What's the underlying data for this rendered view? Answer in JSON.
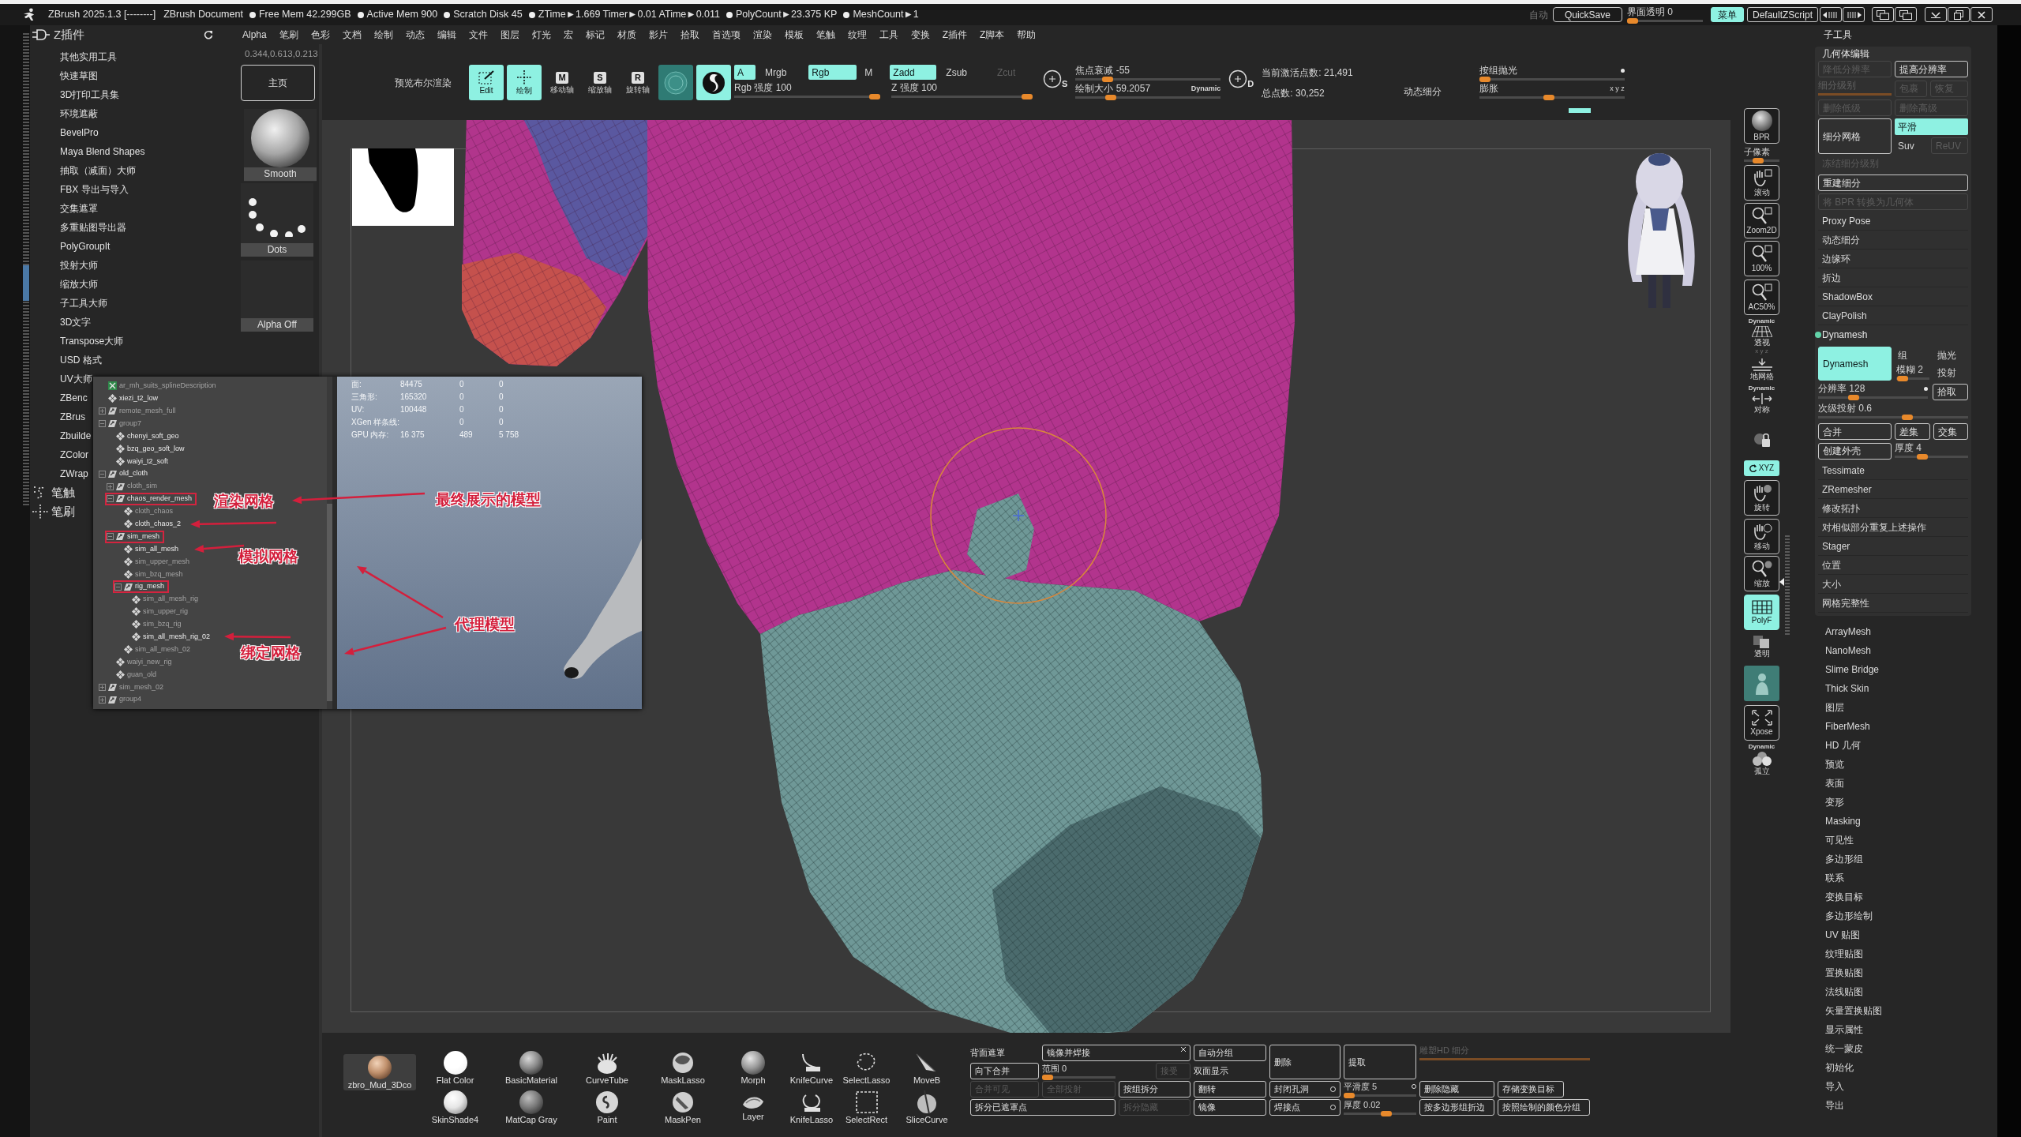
{
  "title_bar": {
    "app_title": "ZBrush 2025.1.3 [--------]",
    "document": "ZBrush Document",
    "stats": [
      "Free Mem 42.299GB",
      "Active Mem 900",
      "Scratch Disk 45",
      "ZTime►1.669 Timer►0.01 ATime►0.011",
      "PolyCount►23.375 KP",
      "MeshCount►1"
    ],
    "auto_label": "自动",
    "quicksave": "QuickSave",
    "ui_transparency": {
      "label": "界面透明 0",
      "level": 0
    },
    "menu_toggle": {
      "label": "菜单",
      "on": true
    },
    "zscript": "DefaultZScript"
  },
  "menu": [
    "Alpha",
    "笔刷",
    "色彩",
    "文档",
    "绘制",
    "动态",
    "编辑",
    "文件",
    "图层",
    "灯光",
    "宏",
    "标记",
    "材质",
    "影片",
    "拾取",
    "首选项",
    "渲染",
    "模板",
    "笔触",
    "纹理",
    "工具",
    "变换",
    "Z插件",
    "Z脚本",
    "帮助"
  ],
  "plugin_panel": {
    "title": "Z插件",
    "items": [
      "其他实用工具",
      "快速草图",
      "3D打印工具集",
      "环境遮蔽",
      "BevelPro",
      "Maya Blend Shapes",
      "抽取（减面）大师",
      "FBX 导出与导入",
      "交集遮罩",
      "多重贴图导出器",
      "PolyGroupIt",
      "投射大师",
      "缩放大师",
      "子工具大师",
      "3D文字",
      "Transpose大师",
      "USD 格式",
      "UV大师",
      "ZBenc",
      "ZBrus",
      "Zbuilde",
      "ZColor",
      "ZWrap"
    ],
    "palettes": [
      {
        "kind": "stroke",
        "label": "笔触"
      },
      {
        "kind": "brush",
        "label": "笔刷"
      }
    ]
  },
  "brush_column": {
    "color_value": "0.344,0.613,0.213",
    "home_button": "主页",
    "brush": "Smooth",
    "stroke": "Dots",
    "alpha": "Alpha Off"
  },
  "toolbar": {
    "boolean_preview": "预览布尔渲染",
    "tools": [
      {
        "kind": "edit",
        "label": "Edit",
        "on": true
      },
      {
        "kind": "draw",
        "label": "绘制",
        "on": true
      },
      {
        "kind": "move",
        "glyph": "M",
        "label": "移动轴",
        "on": false
      },
      {
        "kind": "scale",
        "glyph": "S",
        "label": "缩放轴",
        "on": false
      },
      {
        "kind": "rotate",
        "glyph": "R",
        "label": "旋转轴",
        "on": false
      },
      {
        "kind": "material",
        "on": false
      },
      {
        "kind": "brush",
        "on": true
      }
    ],
    "channels": [
      {
        "label": "A",
        "on": true,
        "disabled": false
      },
      {
        "label": "Mrgb",
        "on": false,
        "disabled": false
      },
      {
        "label": "Rgb",
        "on": true,
        "disabled": false
      },
      {
        "label": "M",
        "on": false,
        "disabled": false
      },
      {
        "label": "Zadd",
        "on": true,
        "disabled": false
      },
      {
        "label": "Zsub",
        "on": false,
        "disabled": false
      },
      {
        "label": "Zcut",
        "on": false,
        "disabled": true
      }
    ],
    "rgb_intensity": {
      "label": "Rgb 强度 100",
      "level": 1
    },
    "z_intensity": {
      "label": "Z 强度 100",
      "level": 1
    },
    "focal_shift": {
      "glyph": "S",
      "label": "焦点衰减 -55",
      "level": 0.2
    },
    "draw_size": {
      "glyph": "D",
      "label": "绘制大小 59.2057",
      "level": 0.22,
      "dynamic": "Dynamic"
    },
    "active_points": "当前激活点数: 21,491",
    "total_points": "总点数: 30,252",
    "dynamic_subdiv": "动态细分",
    "group_polish": {
      "label": "按组抛光",
      "level": 0
    },
    "inflate": {
      "label": "膨胀",
      "level": 0.48,
      "axes": "x y z"
    }
  },
  "subtool_title": "子工具",
  "geometry": {
    "title": "几何体编辑",
    "lower_res": {
      "label": "降低分辨率",
      "disabled": true
    },
    "higher_res": {
      "label": "提高分辨率",
      "disabled": false
    },
    "sdiv": {
      "label": "细分级别",
      "level": 1,
      "disabled": true
    },
    "cage": {
      "label": "包裹",
      "disabled": true
    },
    "restore": {
      "label": "恢复",
      "disabled": true
    },
    "del_lower": {
      "label": "删除低级",
      "disabled": true
    },
    "del_higher": {
      "label": "删除高级",
      "disabled": true
    },
    "divide": "细分网格",
    "smooth": {
      "label": "平滑",
      "on": true
    },
    "suv": {
      "label": "Suv",
      "on": false
    },
    "reuv": {
      "label": "ReUV",
      "disabled": true
    },
    "freeze": {
      "label": "冻结细分级别",
      "disabled": true
    },
    "reconstruct": {
      "label": "重建细分",
      "disabled": false
    },
    "bpr_to_geo": {
      "label": "将 BPR 转换为几何体",
      "disabled": true
    },
    "items_before": [
      "Proxy Pose",
      "动态细分",
      "边缘环",
      "折边",
      "ShadowBox",
      "ClayPolish"
    ],
    "dynamesh": {
      "title": "Dynamesh",
      "button": {
        "label": "Dynamesh",
        "on": true
      },
      "group": {
        "label": "组",
        "on": false
      },
      "polish": {
        "label": "抛光",
        "on": false
      },
      "blur": {
        "label": "模糊 2",
        "level": 0.05
      },
      "project": {
        "label": "投射",
        "on": false
      },
      "resolution": {
        "label": "分辨率 128",
        "level": 0.3
      },
      "pick": "拾取",
      "subprojection": {
        "label": "次级投射 0.6",
        "level": 0.6
      },
      "add": "合并",
      "sub": "差集",
      "and": "交集",
      "create_shell": "创建外壳",
      "thickness": {
        "label": "厚度 4",
        "level": 0.35
      }
    },
    "items_after": [
      "Tessimate",
      "ZRemesher",
      "修改拓扑",
      "对相似部分重复上述操作",
      "Stager",
      "位置",
      "大小",
      "网格完整性"
    ]
  },
  "tool_palettes": [
    "ArrayMesh",
    "NanoMesh",
    "Slime Bridge",
    "Thick Skin",
    "图层",
    "FiberMesh",
    "HD 几何",
    "预览",
    "表面",
    "变形",
    "Masking",
    "可见性",
    "多边形组",
    "联系",
    "变换目标",
    "多边形绘制",
    "UV 贴图",
    "纹理贴图",
    "置换贴图",
    "法线贴图",
    "矢量置换贴图",
    "显示属性",
    "统一蒙皮",
    "初始化",
    "导入",
    "导出"
  ],
  "view_shelf": [
    {
      "kind": "bpr",
      "label": "BPR",
      "on": false
    },
    {
      "kind": "slider",
      "label": "子像素",
      "level": 0.35
    },
    {
      "kind": "hand",
      "label": "滚动",
      "on": false
    },
    {
      "kind": "zoom",
      "label": "Zoom2D",
      "on": false
    },
    {
      "kind": "zoom",
      "label": "100%",
      "on": false
    },
    {
      "kind": "zoom",
      "label": "AC50%",
      "on": false
    },
    {
      "kind": "persp",
      "top": "Dynamic",
      "label": "透视",
      "on": false
    },
    {
      "kind": "floor",
      "top": "x y z",
      "label": "地网格",
      "on": false
    },
    {
      "kind": "sym",
      "top": "Dynamic",
      "label": "对称",
      "on": false
    },
    {
      "kind": "lock",
      "on": false
    },
    {
      "kind": "xyz",
      "label": "XYZ",
      "on": true
    },
    {
      "kind": "rotate",
      "label": "旋转",
      "on": false
    },
    {
      "kind": "move",
      "label": "移动",
      "on": false
    },
    {
      "kind": "scale",
      "label": "缩放",
      "on": false
    },
    {
      "kind": "polyf",
      "label": "PolyF",
      "on": true
    },
    {
      "kind": "transp",
      "label": "透明",
      "on": false
    },
    {
      "kind": "ghost",
      "on": true
    },
    {
      "kind": "xpose",
      "label": "Xpose",
      "on": false
    },
    {
      "kind": "solo",
      "top": "Dynamic",
      "label": "孤立",
      "on": false
    }
  ],
  "shelf": [
    {
      "kind": "clay",
      "label": "zbro_Mud_3Dco",
      "selected": true
    },
    {
      "kind": "flat",
      "label": "Flat Color",
      "selected": false
    },
    {
      "kind": "basic",
      "label": "BasicMaterial",
      "selected": false
    },
    {
      "kind": "curvetube",
      "label": "CurveTube",
      "selected": false
    },
    {
      "kind": "masklasso",
      "label": "MaskLasso",
      "selected": false
    },
    {
      "kind": "morph",
      "label": "Morph",
      "selected": false
    },
    {
      "kind": "knifecurve",
      "label": "KnifeCurve",
      "selected": false
    },
    {
      "kind": "selectlasso",
      "label": "SelectLasso",
      "selected": false
    },
    {
      "kind": "moveb",
      "label": "MoveB",
      "selected": false
    },
    {
      "kind": "skinshade",
      "label": "SkinShade4",
      "selected": false
    },
    {
      "kind": "matcap",
      "label": "MatCap Gray",
      "selected": false
    },
    {
      "kind": "paint",
      "label": "Paint",
      "selected": false
    },
    {
      "kind": "maskpen",
      "label": "MaskPen",
      "selected": false
    },
    {
      "kind": "layer",
      "label": "Layer",
      "selected": false
    },
    {
      "kind": "knifelasso",
      "label": "KnifeLasso",
      "selected": false
    },
    {
      "kind": "selectrect",
      "label": "SelectRect",
      "selected": false
    },
    {
      "kind": "slicecurve",
      "label": "SliceCurve",
      "selected": false
    }
  ],
  "mesh_ops": [
    {
      "kind": "label",
      "label": "背面遮罩",
      "disabled": false
    },
    {
      "kind": "axisbutton",
      "label": "镜像并焊接",
      "disabled": false
    },
    {
      "kind": "button",
      "label": "自动分组",
      "disabled": false
    },
    {
      "kind": "button",
      "label": "删除",
      "disabled": false
    },
    {
      "kind": "button",
      "label": "提取",
      "disabled": false
    },
    {
      "kind": "slider",
      "label": "雕塑HD 细分",
      "level": 1,
      "disabled": true
    },
    {
      "kind": "button",
      "label": "向下合并",
      "disabled": false
    },
    {
      "kind": "slider",
      "label": "范围 0",
      "level": 0,
      "disabled": false
    },
    {
      "kind": "button",
      "label": "接受",
      "disabled": true
    },
    {
      "kind": "label",
      "label": "双面显示",
      "disabled": false
    },
    {
      "kind": "button",
      "label": "合并可见",
      "disabled": true
    },
    {
      "kind": "button",
      "label": "全部投射",
      "disabled": true
    },
    {
      "kind": "button",
      "label": "按组拆分",
      "disabled": false
    },
    {
      "kind": "button",
      "label": "翻转",
      "disabled": false
    },
    {
      "kind": "toggle",
      "label": "封闭孔洞",
      "disabled": false
    },
    {
      "kind": "dotslider",
      "label": "平滑度 5",
      "level": 0,
      "disabled": false
    },
    {
      "kind": "button",
      "label": "删除隐藏",
      "disabled": false
    },
    {
      "kind": "button",
      "label": "存储变换目标",
      "disabled": false
    },
    {
      "kind": "button",
      "label": "拆分已遮罩点",
      "disabled": false
    },
    {
      "kind": "button",
      "label": "拆分隐藏",
      "disabled": true
    },
    {
      "kind": "button",
      "label": "镜像",
      "disabled": false
    },
    {
      "kind": "toggle",
      "label": "焊接点",
      "disabled": false
    },
    {
      "kind": "slider",
      "label": "厚度 0.02",
      "level": 0.6,
      "disabled": false
    },
    {
      "kind": "button",
      "label": "按多边形组折边",
      "disabled": false
    },
    {
      "kind": "button",
      "label": "按照绘制的颜色分组",
      "disabled": false
    }
  ],
  "inset": {
    "outliner": [
      {
        "kind": "xgen",
        "name": "ar_mh_suits_splineDescription",
        "dim": true,
        "boxed": false
      },
      {
        "kind": "mesh",
        "name": "xiezi_t2_low",
        "dim": false,
        "boxed": false
      },
      {
        "kind": "group",
        "name": "remote_mesh_full",
        "expanded": false,
        "dim": true,
        "boxed": false
      },
      {
        "kind": "group",
        "name": "group7",
        "expanded": true,
        "dim": true,
        "boxed": false,
        "children": [
          {
            "kind": "mesh",
            "name": "chenyi_soft_geo",
            "dim": false,
            "boxed": false
          },
          {
            "kind": "mesh",
            "name": "bzq_geo_soft_low",
            "dim": false,
            "boxed": false
          },
          {
            "kind": "mesh",
            "name": "waiyi_t2_soft",
            "dim": false,
            "boxed": false
          }
        ]
      },
      {
        "kind": "group",
        "name": "old_cloth",
        "expanded": true,
        "dim": false,
        "boxed": false,
        "children": [
          {
            "kind": "group",
            "name": "cloth_sim",
            "expanded": false,
            "dim": true,
            "boxed": false
          },
          {
            "kind": "group",
            "name": "chaos_render_mesh",
            "expanded": true,
            "dim": false,
            "boxed": true,
            "children": [
              {
                "kind": "mesh",
                "name": "cloth_chaos",
                "dim": true,
                "boxed": false
              },
              {
                "kind": "mesh",
                "name": "cloth_chaos_2",
                "dim": false,
                "boxed": false
              }
            ]
          },
          {
            "kind": "group",
            "name": "sim_mesh",
            "expanded": true,
            "dim": false,
            "boxed": true,
            "children": [
              {
                "kind": "mesh",
                "name": "sim_all_mesh",
                "dim": false,
                "boxed": false
              },
              {
                "kind": "mesh",
                "name": "sim_upper_mesh",
                "dim": true,
                "boxed": false
              },
              {
                "kind": "mesh",
                "name": "sim_bzq_mesh",
                "dim": true,
                "boxed": false
              },
              {
                "kind": "group",
                "name": "rig_mesh",
                "expanded": true,
                "dim": false,
                "boxed": true,
                "children": [
                  {
                    "kind": "mesh",
                    "name": "sim_all_mesh_rig",
                    "dim": true,
                    "boxed": false
                  },
                  {
                    "kind": "mesh",
                    "name": "sim_upper_rig",
                    "dim": true,
                    "boxed": false
                  },
                  {
                    "kind": "mesh",
                    "name": "sim_bzq_rig",
                    "dim": true,
                    "boxed": false
                  },
                  {
                    "kind": "mesh",
                    "name": "sim_all_mesh_rig_02",
                    "dim": false,
                    "boxed": false
                  }
                ]
              },
              {
                "kind": "mesh",
                "name": "sim_all_mesh_02",
                "dim": true,
                "boxed": false
              }
            ]
          },
          {
            "kind": "mesh",
            "name": "waiyi_new_rig",
            "dim": true,
            "boxed": false
          },
          {
            "kind": "mesh",
            "name": "guan_old",
            "dim": true,
            "boxed": false
          }
        ]
      },
      {
        "kind": "group",
        "name": "sim_mesh_02",
        "expanded": false,
        "dim": true,
        "boxed": false
      },
      {
        "kind": "group",
        "name": "group4",
        "expanded": false,
        "dim": true,
        "boxed": false
      }
    ],
    "hud": [
      {
        "label": "面:",
        "values": [
          "84475",
          "0",
          "0"
        ]
      },
      {
        "label": "三角形:",
        "values": [
          "165320",
          "0",
          "0"
        ]
      },
      {
        "label": "UV:",
        "values": [
          "100448",
          "0",
          "0"
        ]
      },
      {
        "label": "XGen 样条线:",
        "values": [
          "0",
          "0"
        ]
      },
      {
        "label": "GPU 内存:",
        "values": [
          "16 375",
          "489",
          "5 758"
        ]
      }
    ],
    "annotations": [
      {
        "text": "渲染网格"
      },
      {
        "text": "最终展示的模型"
      },
      {
        "text": "模拟网格"
      },
      {
        "text": "代理模型"
      },
      {
        "text": "绑定网格"
      }
    ]
  }
}
